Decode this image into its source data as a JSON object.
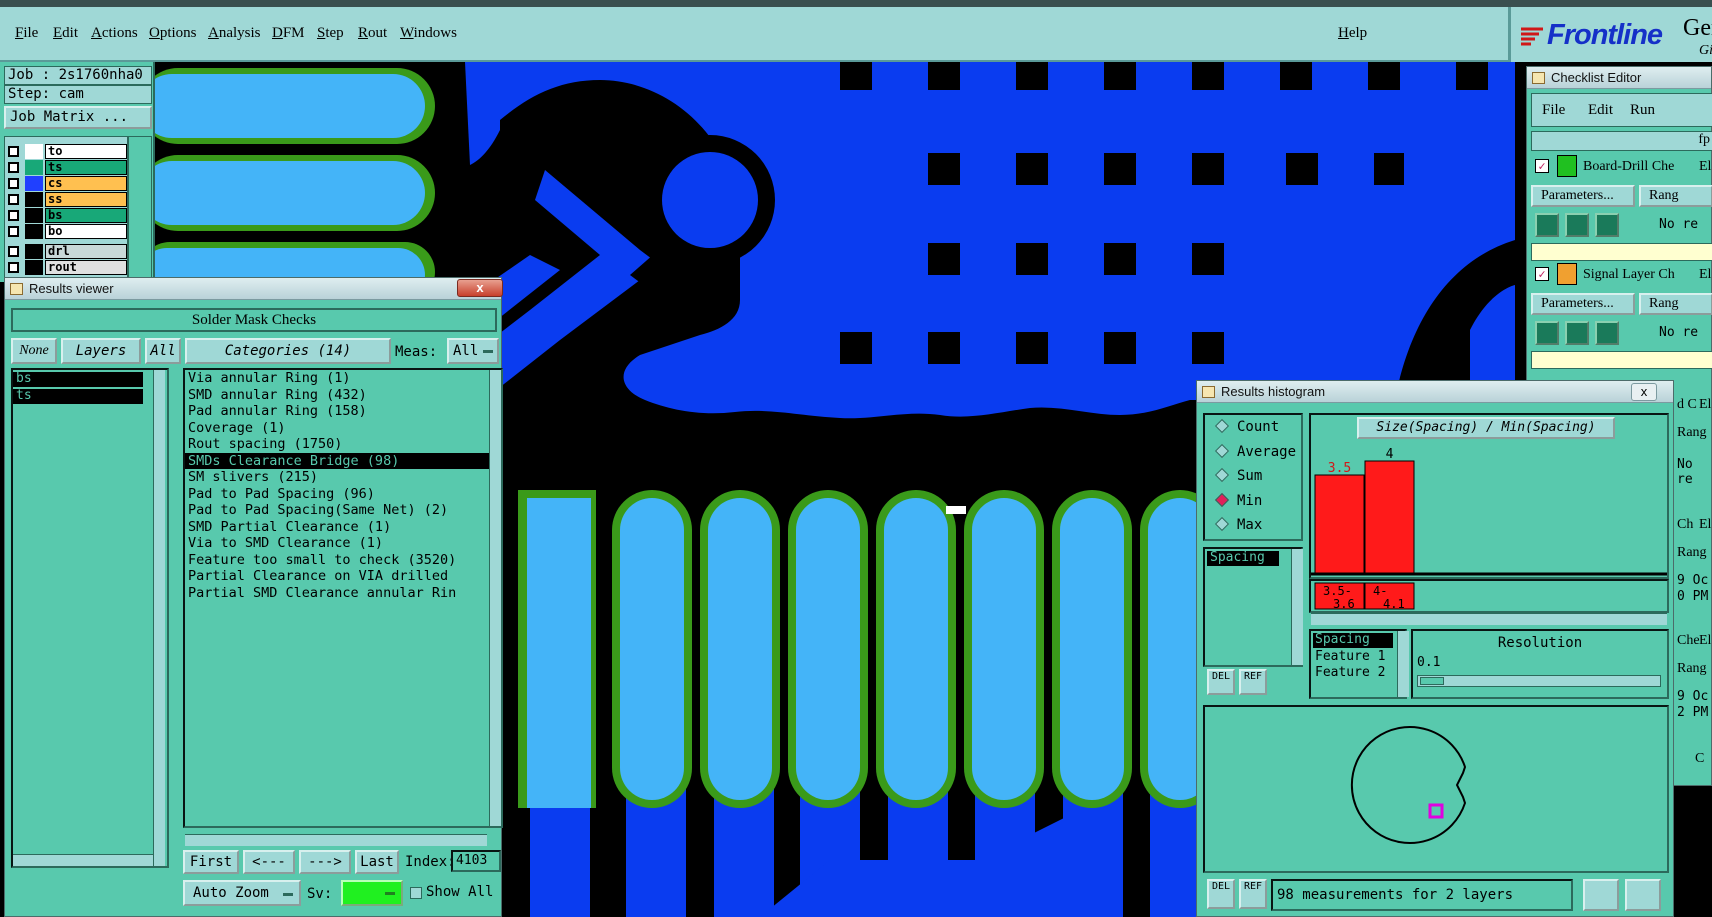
{
  "menubar": {
    "items": [
      "File",
      "Edit",
      "Actions",
      "Options",
      "Analysis",
      "DFM",
      "Step",
      "Rout",
      "Windows"
    ],
    "help": "Help",
    "logo_text": "Frontline",
    "logo_gen": "Ger",
    "logo_sub": "Gi"
  },
  "job": {
    "job_label": "Job : 2s1760nha0",
    "step_label": "Step: cam",
    "matrix_button": "Job Matrix ...",
    "layers": [
      {
        "name": "to",
        "color": "#ffffff",
        "swatch": "#ffffff"
      },
      {
        "name": "ts",
        "color": "#18a878",
        "swatch": "#18a878"
      },
      {
        "name": "cs",
        "color": "#ffc050",
        "swatch": "#2040ff"
      },
      {
        "name": "ss",
        "color": "#ffc050",
        "swatch": "#000000"
      },
      {
        "name": "bs",
        "color": "#18a878",
        "swatch": "#000000"
      },
      {
        "name": "bo",
        "color": "#ffffff",
        "swatch": "#000000"
      },
      {
        "name": "drl",
        "color": "#c8d8d8",
        "swatch": "#000000"
      },
      {
        "name": "rout",
        "color": "#e0e0e0",
        "swatch": "#000000"
      }
    ]
  },
  "results_viewer": {
    "title": "Results viewer",
    "close": "x",
    "heading": "Solder Mask Checks",
    "btn_none": "None",
    "btn_layers": "Layers",
    "btn_all": "All",
    "btn_categories": "Categories (14)",
    "meas_label": "Meas:",
    "meas_value": "All",
    "layers": [
      "bs",
      "ts"
    ],
    "categories": [
      "Via annular Ring (1)",
      "SMD annular Ring (432)",
      "Pad annular Ring (158)",
      "Coverage (1)",
      "Rout spacing (1750)",
      "SMDs Clearance Bridge (98)",
      "SM slivers (215)",
      "Pad to Pad Spacing (96)",
      "Pad to Pad Spacing(Same Net) (2)",
      "SMD Partial Clearance (1)",
      "Via to SMD Clearance (1)",
      "Feature too small to check (3520)",
      "Partial Clearance on VIA drilled",
      "Partial SMD Clearance annular Rin"
    ],
    "selected_category": 5,
    "nav": {
      "first": "First",
      "prev": "<---",
      "next": "--->",
      "last": "Last",
      "index_label": "Index:",
      "index_value": "4103"
    },
    "auto_zoom": "Auto Zoom",
    "sv_label": "Sv:",
    "show_all": "Show All"
  },
  "checklist": {
    "title": "Checklist Editor",
    "menu": [
      "File",
      "Edit",
      "Run"
    ],
    "col_label": "fp",
    "params": "Parameters...",
    "range": "Rang",
    "items": [
      {
        "title": "Board-Drill Che",
        "tail": "El",
        "status": "No re"
      },
      {
        "title": "Signal Layer Ch",
        "tail": "El",
        "status": "No re"
      }
    ],
    "partial": [
      "d C",
      "El",
      "Rang",
      "No re",
      "Ch",
      "El",
      "Rang",
      "9 Oc",
      "0 PM",
      "Che",
      "El",
      "Rang",
      "9 Oc",
      "2 PM",
      "C"
    ]
  },
  "histogram": {
    "title": "Results histogram",
    "close": "x",
    "modes": [
      "Count",
      "Average",
      "Sum",
      "Min",
      "Max"
    ],
    "selected_mode": 3,
    "measure_list": [
      "Spacing"
    ],
    "chart_title": "Size(Spacing) / Min(Spacing)",
    "bins": [
      {
        "label_top": "3.5-",
        "label_bottom": "3.6",
        "value": 3.5
      },
      {
        "label_top": "4-",
        "label_bottom": "4.1",
        "value": 4
      }
    ],
    "bar_labels": [
      "3.5",
      "4"
    ],
    "fields": [
      "Spacing",
      "Feature 1",
      "Feature 2"
    ],
    "resolution_label": "Resolution",
    "resolution_value": "0.1",
    "del": "DEL",
    "ref": "REF",
    "status": "98 measurements for 2 layers"
  }
}
